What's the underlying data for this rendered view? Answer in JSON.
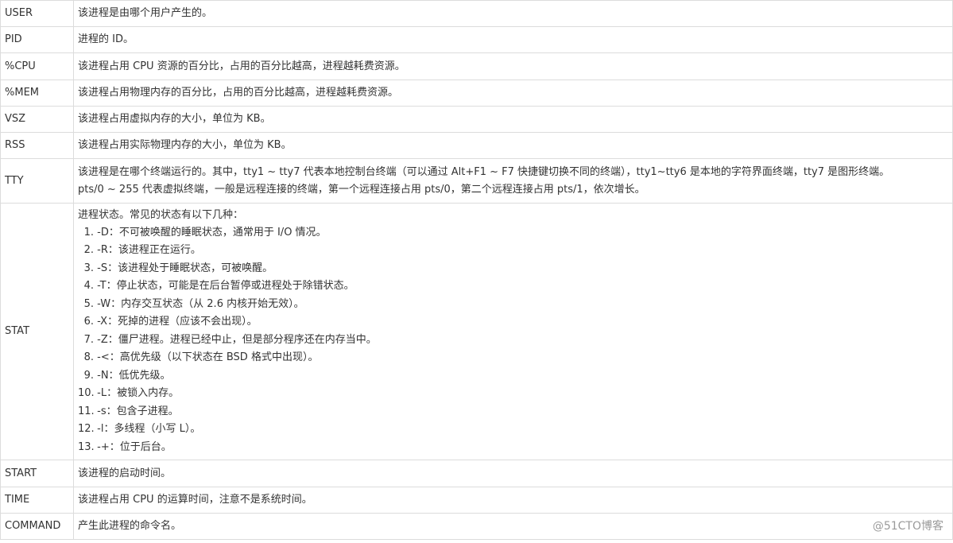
{
  "rows": [
    {
      "key": "USER",
      "desc": "该进程是由哪个用户产生的。"
    },
    {
      "key": "PID",
      "desc": "进程的 ID。"
    },
    {
      "key": "%CPU",
      "desc": "该进程占用 CPU 资源的百分比，占用的百分比越高，进程越耗费资源。"
    },
    {
      "key": "%MEM",
      "desc": "该进程占用物理内存的百分比，占用的百分比越高，进程越耗费资源。"
    },
    {
      "key": "VSZ",
      "desc": "该进程占用虚拟内存的大小，单位为 KB。"
    },
    {
      "key": "RSS",
      "desc": "该进程占用实际物理内存的大小，单位为 KB。"
    },
    {
      "key": "TTY",
      "lines": [
        "该进程是在哪个终端运行的。其中，tty1 ~ tty7 代表本地控制台终端（可以通过 Alt+F1 ~ F7 快捷键切换不同的终端），tty1~tty6 是本地的字符界面终端，tty7 是图形终端。",
        "pts/0 ~ 255 代表虚拟终端，一般是远程连接的终端，第一个远程连接占用 pts/0，第二个远程连接占用 pts/1，依次增长。"
      ]
    },
    {
      "key": "STAT",
      "intro": "进程状态。常见的状态有以下几种：",
      "items": [
        {
          "num": "1.",
          "text": "-D：不可被唤醒的睡眠状态，通常用于 I/O 情况。"
        },
        {
          "num": "2.",
          "text": "-R：该进程正在运行。"
        },
        {
          "num": "3.",
          "text": "-S：该进程处于睡眠状态，可被唤醒。"
        },
        {
          "num": "4.",
          "text": "-T：停止状态，可能是在后台暂停或进程处于除错状态。"
        },
        {
          "num": "5.",
          "text": "-W：内存交互状态（从 2.6 内核开始无效）。"
        },
        {
          "num": "6.",
          "text": "-X：死掉的进程（应该不会出现）。"
        },
        {
          "num": "7.",
          "text": "-Z：僵尸进程。进程已经中止，但是部分程序还在内存当中。"
        },
        {
          "num": "8.",
          "text": "-<：高优先级（以下状态在 BSD 格式中出现）。"
        },
        {
          "num": "9.",
          "text": "-N：低优先级。"
        },
        {
          "num": "10.",
          "text": "-L：被锁入内存。"
        },
        {
          "num": "11.",
          "text": "-s：包含子进程。"
        },
        {
          "num": "12.",
          "text": "-l：多线程（小写 L）。"
        },
        {
          "num": "13.",
          "text": "-+：位于后台。"
        }
      ]
    },
    {
      "key": "START",
      "desc": "该进程的启动时间。"
    },
    {
      "key": "TIME",
      "desc": "该进程占用 CPU 的运算时间，注意不是系统时间。"
    },
    {
      "key": "COMMAND",
      "desc": "产生此进程的命令名。"
    }
  ],
  "watermark": "@51CTO博客"
}
